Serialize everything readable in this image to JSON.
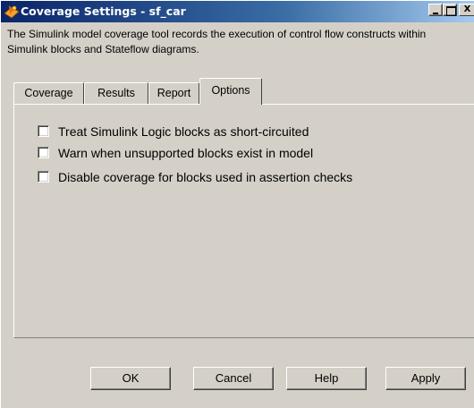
{
  "window": {
    "title": "Coverage Settings - sf_car",
    "controls": {
      "minimize": "_",
      "maximize": "□",
      "close": "X"
    }
  },
  "description": "The Simulink model coverage tool records the execution of control flow constructs within Simulink blocks and Stateflow diagrams.",
  "tabs": [
    {
      "label": "Coverage",
      "active": false
    },
    {
      "label": "Results",
      "active": false
    },
    {
      "label": "Report",
      "active": false
    },
    {
      "label": "Options",
      "active": true
    }
  ],
  "options": [
    {
      "label": "Treat Simulink Logic blocks as short-circuited",
      "checked": false
    },
    {
      "label": "Warn when unsupported blocks exist in model",
      "checked": false
    },
    {
      "label": "Disable coverage for blocks used in assertion checks",
      "checked": false
    }
  ],
  "buttons": {
    "ok": "OK",
    "cancel": "Cancel",
    "help": "Help",
    "apply": "Apply"
  },
  "colors": {
    "face": "#d4d0c8",
    "title_start": "#0a246a",
    "title_end": "#a6caf0",
    "title_text": "#ffffff"
  },
  "icons": {
    "app": "stateflow-icon"
  }
}
